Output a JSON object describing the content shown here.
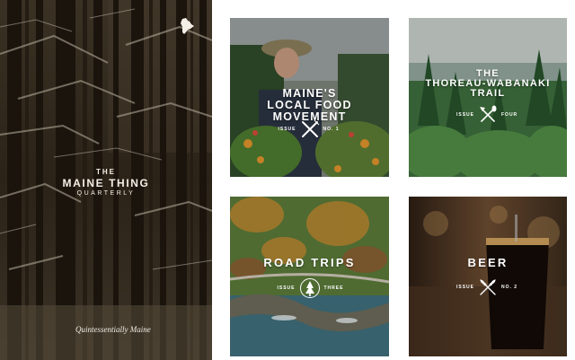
{
  "cover": {
    "masthead_the": "THE",
    "masthead_name": "MAINE THING",
    "masthead_sub": "QUARTERLY",
    "tagline": "Quintessentially Maine",
    "state_icon": "maine-state-icon"
  },
  "tiles": [
    {
      "title_lines": [
        "MAINE'S",
        "LOCAL FOOD",
        "MOVEMENT"
      ],
      "issue_label": "ISSUE",
      "issue_number": "NO. 1",
      "emblem_icon": "crossed-knife-fork-icon"
    },
    {
      "title_lines": [
        "THE",
        "THOREAU-WABANAKI",
        "TRAIL"
      ],
      "issue_label": "ISSUE",
      "issue_number": "FOUR",
      "emblem_icon": "crossed-axe-paddle-icon"
    },
    {
      "title_lines": [
        "ROAD TRIPS"
      ],
      "issue_label": "ISSUE",
      "issue_number": "THREE",
      "emblem_icon": "pine-tree-icon"
    },
    {
      "title_lines": [
        "BEER"
      ],
      "issue_label": "ISSUE",
      "issue_number": "NO. 2",
      "emblem_icon": "crossed-wheat-icon"
    }
  ],
  "colors": {
    "cover_bg": "#2d251b",
    "text_light": "#ffffff",
    "page_bg": "#ffffff"
  }
}
